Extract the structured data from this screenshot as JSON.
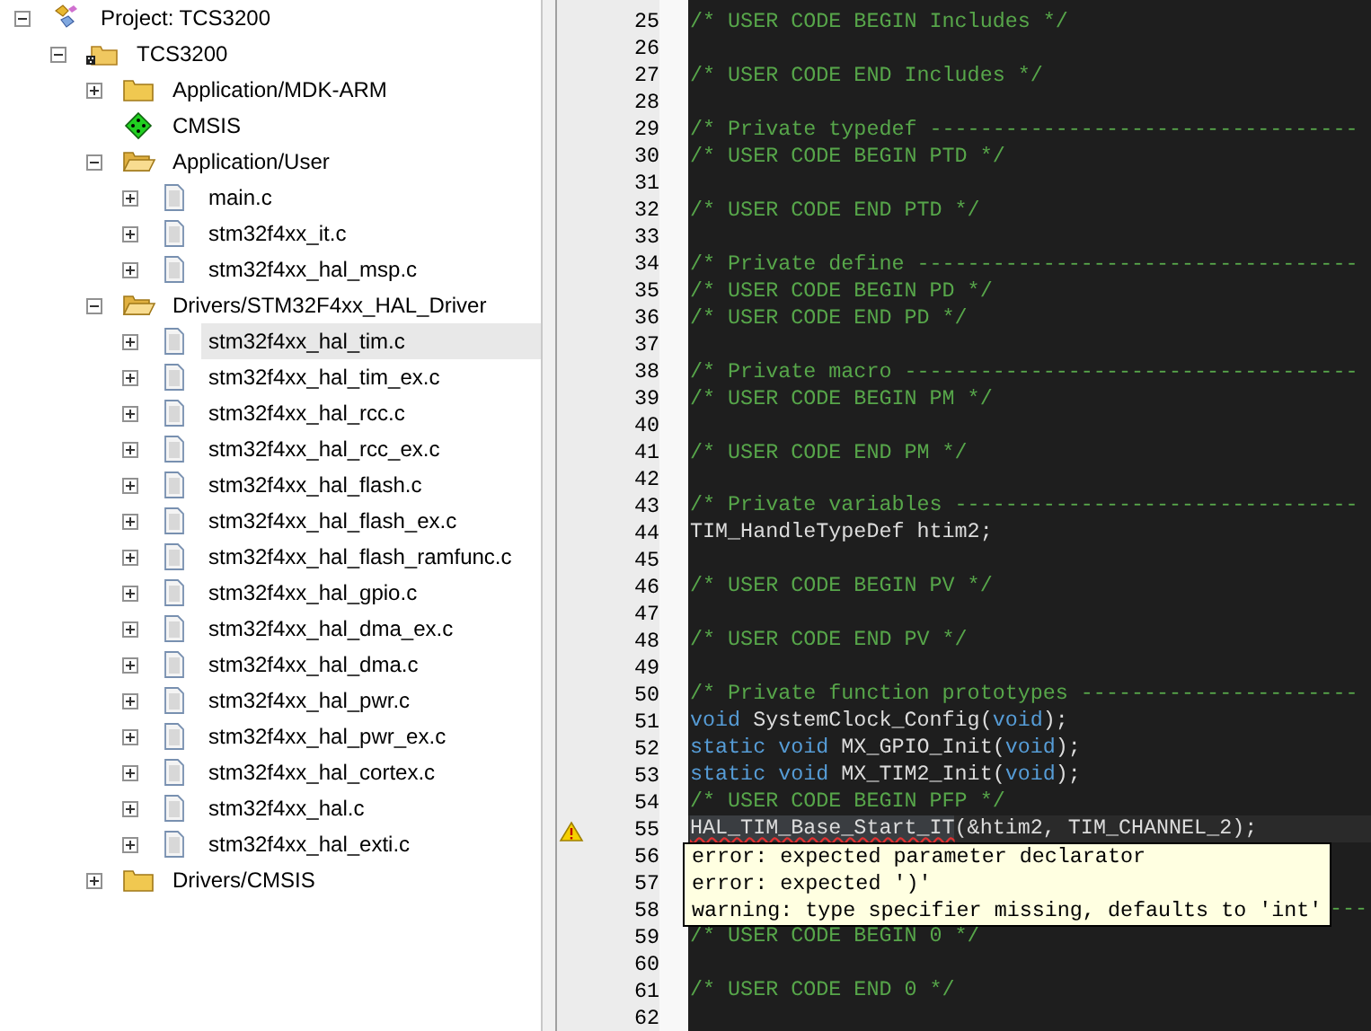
{
  "project_tree": [
    {
      "label": "Project: TCS3200",
      "kind": "project",
      "expanded": true,
      "selected": false,
      "children": [
        {
          "label": "TCS3200",
          "kind": "target",
          "expanded": true,
          "selected": false,
          "children": [
            {
              "label": "Application/MDK-ARM",
              "kind": "folder",
              "expanded": false,
              "selected": false
            },
            {
              "label": "CMSIS",
              "kind": "cmsis",
              "selected": false
            },
            {
              "label": "Application/User",
              "kind": "folder",
              "expanded": true,
              "selected": false,
              "children": [
                {
                  "label": "main.c",
                  "kind": "file",
                  "expanded": false,
                  "selected": false
                },
                {
                  "label": "stm32f4xx_it.c",
                  "kind": "file",
                  "expanded": false,
                  "selected": false
                },
                {
                  "label": "stm32f4xx_hal_msp.c",
                  "kind": "file",
                  "expanded": false,
                  "selected": false
                }
              ]
            },
            {
              "label": "Drivers/STM32F4xx_HAL_Driver",
              "kind": "folder",
              "expanded": true,
              "selected": false,
              "children": [
                {
                  "label": "stm32f4xx_hal_tim.c",
                  "kind": "file",
                  "expanded": false,
                  "selected": true
                },
                {
                  "label": "stm32f4xx_hal_tim_ex.c",
                  "kind": "file",
                  "expanded": false,
                  "selected": false
                },
                {
                  "label": "stm32f4xx_hal_rcc.c",
                  "kind": "file",
                  "expanded": false,
                  "selected": false
                },
                {
                  "label": "stm32f4xx_hal_rcc_ex.c",
                  "kind": "file",
                  "expanded": false,
                  "selected": false
                },
                {
                  "label": "stm32f4xx_hal_flash.c",
                  "kind": "file",
                  "expanded": false,
                  "selected": false
                },
                {
                  "label": "stm32f4xx_hal_flash_ex.c",
                  "kind": "file",
                  "expanded": false,
                  "selected": false
                },
                {
                  "label": "stm32f4xx_hal_flash_ramfunc.c",
                  "kind": "file",
                  "expanded": false,
                  "selected": false
                },
                {
                  "label": "stm32f4xx_hal_gpio.c",
                  "kind": "file",
                  "expanded": false,
                  "selected": false
                },
                {
                  "label": "stm32f4xx_hal_dma_ex.c",
                  "kind": "file",
                  "expanded": false,
                  "selected": false
                },
                {
                  "label": "stm32f4xx_hal_dma.c",
                  "kind": "file",
                  "expanded": false,
                  "selected": false
                },
                {
                  "label": "stm32f4xx_hal_pwr.c",
                  "kind": "file",
                  "expanded": false,
                  "selected": false
                },
                {
                  "label": "stm32f4xx_hal_pwr_ex.c",
                  "kind": "file",
                  "expanded": false,
                  "selected": false
                },
                {
                  "label": "stm32f4xx_hal_cortex.c",
                  "kind": "file",
                  "expanded": false,
                  "selected": false
                },
                {
                  "label": "stm32f4xx_hal.c",
                  "kind": "file",
                  "expanded": false,
                  "selected": false
                },
                {
                  "label": "stm32f4xx_hal_exti.c",
                  "kind": "file",
                  "expanded": false,
                  "selected": false
                }
              ]
            },
            {
              "label": "Drivers/CMSIS",
              "kind": "folder",
              "expanded": false,
              "selected": false
            }
          ]
        }
      ]
    }
  ],
  "editor": {
    "lines": [
      {
        "number": "25",
        "warning": false,
        "current": false,
        "tokens": [
          {
            "kind": "comment",
            "text": "/* USER CODE BEGIN Includes */"
          }
        ]
      },
      {
        "number": "26",
        "warning": false,
        "current": false
      },
      {
        "number": "27",
        "warning": false,
        "current": false,
        "tokens": [
          {
            "kind": "comment",
            "text": "/* USER CODE END Includes */"
          }
        ]
      },
      {
        "number": "28",
        "warning": false,
        "current": false
      },
      {
        "number": "29",
        "warning": false,
        "current": false,
        "tokens": [
          {
            "kind": "comment",
            "text": "/* Private typedef ----------------------------------"
          }
        ]
      },
      {
        "number": "30",
        "warning": false,
        "current": false,
        "tokens": [
          {
            "kind": "comment",
            "text": "/* USER CODE BEGIN PTD */"
          }
        ]
      },
      {
        "number": "31",
        "warning": false,
        "current": false
      },
      {
        "number": "32",
        "warning": false,
        "current": false,
        "tokens": [
          {
            "kind": "comment",
            "text": "/* USER CODE END PTD */"
          }
        ]
      },
      {
        "number": "33",
        "warning": false,
        "current": false
      },
      {
        "number": "34",
        "warning": false,
        "current": false,
        "tokens": [
          {
            "kind": "comment",
            "text": "/* Private define -----------------------------------"
          }
        ]
      },
      {
        "number": "35",
        "warning": false,
        "current": false,
        "tokens": [
          {
            "kind": "comment",
            "text": "/* USER CODE BEGIN PD */"
          }
        ]
      },
      {
        "number": "36",
        "warning": false,
        "current": false,
        "tokens": [
          {
            "kind": "comment",
            "text": "/* USER CODE END PD */"
          }
        ]
      },
      {
        "number": "37",
        "warning": false,
        "current": false
      },
      {
        "number": "38",
        "warning": false,
        "current": false,
        "tokens": [
          {
            "kind": "comment",
            "text": "/* Private macro ------------------------------------"
          }
        ]
      },
      {
        "number": "39",
        "warning": false,
        "current": false,
        "tokens": [
          {
            "kind": "comment",
            "text": "/* USER CODE BEGIN PM */"
          }
        ]
      },
      {
        "number": "40",
        "warning": false,
        "current": false
      },
      {
        "number": "41",
        "warning": false,
        "current": false,
        "tokens": [
          {
            "kind": "comment",
            "text": "/* USER CODE END PM */"
          }
        ]
      },
      {
        "number": "42",
        "warning": false,
        "current": false
      },
      {
        "number": "43",
        "warning": false,
        "current": false,
        "tokens": [
          {
            "kind": "comment",
            "text": "/* Private variables --------------------------------"
          }
        ]
      },
      {
        "number": "44",
        "warning": false,
        "current": false,
        "tokens": [
          {
            "kind": "plain",
            "text": "TIM_HandleTypeDef htim2;"
          }
        ]
      },
      {
        "number": "45",
        "warning": false,
        "current": false
      },
      {
        "number": "46",
        "warning": false,
        "current": false,
        "tokens": [
          {
            "kind": "comment",
            "text": "/* USER CODE BEGIN PV */"
          }
        ]
      },
      {
        "number": "47",
        "warning": false,
        "current": false
      },
      {
        "number": "48",
        "warning": false,
        "current": false,
        "tokens": [
          {
            "kind": "comment",
            "text": "/* USER CODE END PV */"
          }
        ]
      },
      {
        "number": "49",
        "warning": false,
        "current": false
      },
      {
        "number": "50",
        "warning": false,
        "current": false,
        "tokens": [
          {
            "kind": "comment",
            "text": "/* Private function prototypes ----------------------"
          }
        ]
      },
      {
        "number": "51",
        "warning": false,
        "current": false,
        "tokens": [
          {
            "kind": "keyword",
            "text": "void"
          },
          {
            "kind": "plain",
            "text": " SystemClock_Config("
          },
          {
            "kind": "keyword",
            "text": "void"
          },
          {
            "kind": "plain",
            "text": ");"
          }
        ]
      },
      {
        "number": "52",
        "warning": false,
        "current": false,
        "tokens": [
          {
            "kind": "keyword",
            "text": "static void"
          },
          {
            "kind": "plain",
            "text": " MX_GPIO_Init("
          },
          {
            "kind": "keyword",
            "text": "void"
          },
          {
            "kind": "plain",
            "text": ");"
          }
        ]
      },
      {
        "number": "53",
        "warning": false,
        "current": false,
        "tokens": [
          {
            "kind": "keyword",
            "text": "static void"
          },
          {
            "kind": "plain",
            "text": " MX_TIM2_Init("
          },
          {
            "kind": "keyword",
            "text": "void"
          },
          {
            "kind": "plain",
            "text": ");"
          }
        ]
      },
      {
        "number": "54",
        "warning": false,
        "current": false,
        "tokens": [
          {
            "kind": "comment",
            "text": "/* USER CODE BEGIN PFP */"
          }
        ]
      },
      {
        "number": "55",
        "warning": true,
        "current": true,
        "tokens": [
          {
            "kind": "error",
            "text": "HAL_TIM_Base_Start_IT"
          },
          {
            "kind": "plain",
            "text": "(&htim2, TIM_CHANNEL_2);"
          }
        ]
      },
      {
        "number": "56",
        "warning": false,
        "current": false
      },
      {
        "number": "57",
        "warning": false,
        "current": false
      },
      {
        "number": "58",
        "warning": false,
        "current": false,
        "tokens": [
          {
            "kind": "tail",
            "text": "---"
          }
        ]
      },
      {
        "number": "59",
        "warning": false,
        "current": false,
        "tokens": [
          {
            "kind": "comment",
            "text": "/* USER CODE BEGIN 0 */"
          }
        ]
      },
      {
        "number": "60",
        "warning": false,
        "current": false
      },
      {
        "number": "61",
        "warning": false,
        "current": false,
        "tokens": [
          {
            "kind": "comment",
            "text": "/* USER CODE END 0 */"
          }
        ]
      },
      {
        "number": "62",
        "warning": false,
        "current": false
      }
    ],
    "tooltip": [
      "error: expected parameter declarator",
      "error: expected ')'",
      "warning: type specifier missing, defaults to 'int'"
    ]
  }
}
